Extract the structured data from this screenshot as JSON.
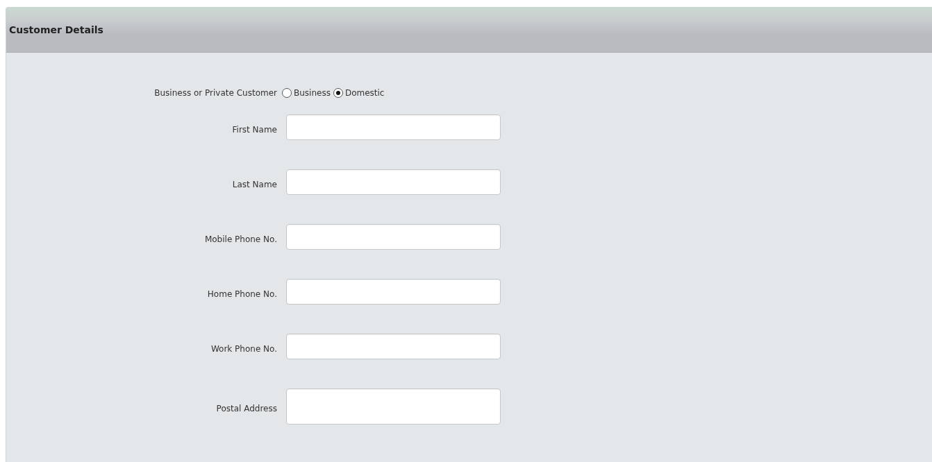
{
  "panel": {
    "title": "Customer Details"
  },
  "customer_type": {
    "label": "Business or Private Customer",
    "options": [
      {
        "label": "Business",
        "selected": false
      },
      {
        "label": "Domestic",
        "selected": true
      }
    ]
  },
  "fields": [
    {
      "label": "First Name",
      "kind": "line"
    },
    {
      "label": "Last Name",
      "kind": "line"
    },
    {
      "label": "Mobile Phone No.",
      "kind": "line"
    },
    {
      "label": "Home Phone No.",
      "kind": "line"
    },
    {
      "label": "Work Phone No.",
      "kind": "line"
    },
    {
      "label": "Postal Address",
      "kind": "multiline"
    }
  ]
}
